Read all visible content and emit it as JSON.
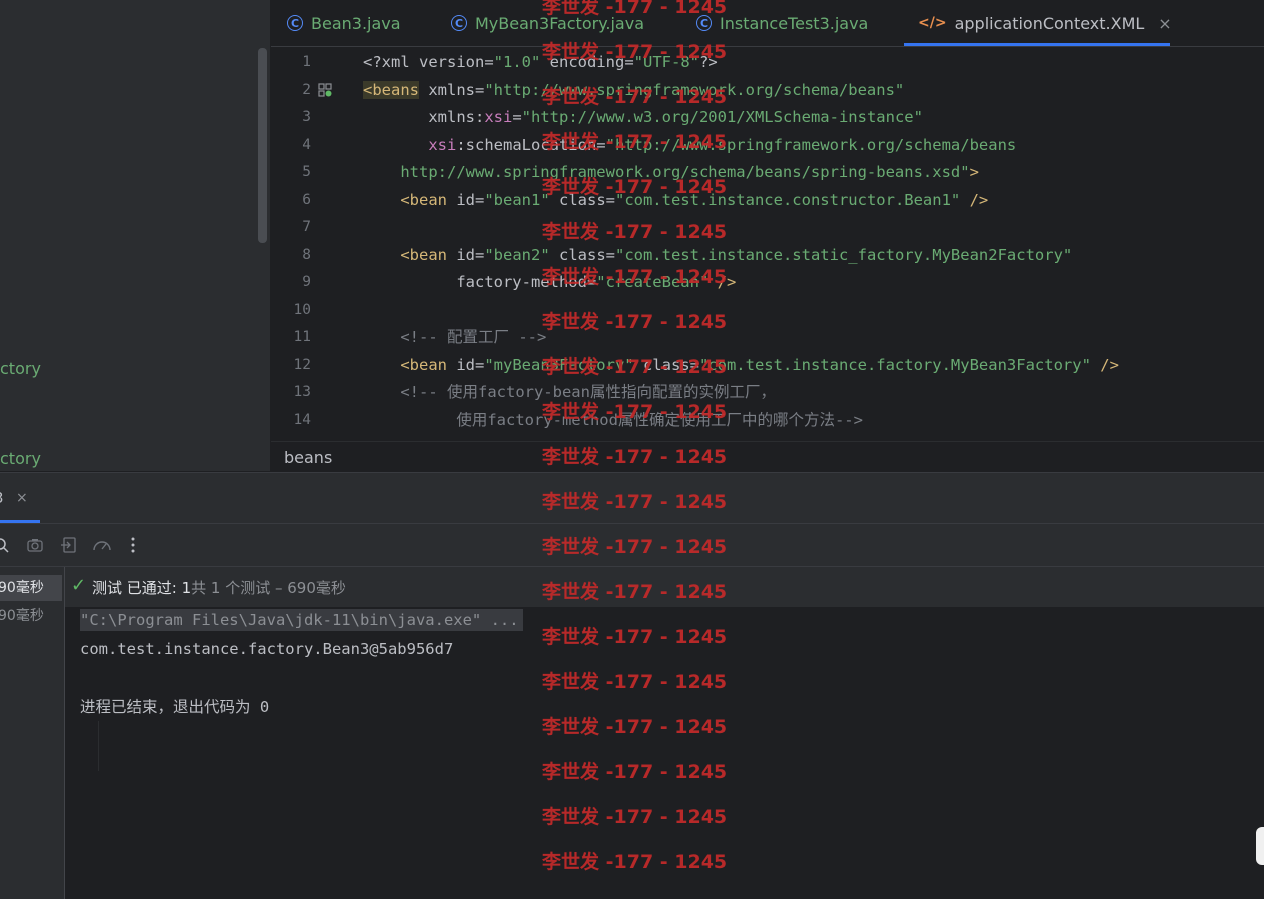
{
  "project_tree": {
    "items": [
      "ctory",
      "ctory"
    ]
  },
  "tabs": [
    {
      "label": "Bean3.java",
      "icon": "java-class-icon"
    },
    {
      "label": "MyBean3Factory.java",
      "icon": "java-class-icon"
    },
    {
      "label": "InstanceTest3.java",
      "icon": "java-class-icon"
    },
    {
      "label": "applicationContext.XML",
      "icon": "xml-file-icon",
      "active": true
    }
  ],
  "editor": {
    "lines": [
      {
        "n": "1",
        "segs": [
          [
            "t-attr",
            "<?xml version="
          ],
          [
            "t-str",
            "\"1.0\""
          ],
          [
            "t-attr",
            " encoding="
          ],
          [
            "t-str",
            "\"UTF-8\""
          ],
          [
            "t-attr",
            "?>"
          ]
        ]
      },
      {
        "n": "2",
        "segs": [
          [
            "t-tag t-tagbg",
            "<beans"
          ],
          [
            "t-attr",
            " xmlns="
          ],
          [
            "t-str",
            "\"http://www.springframework.org/schema/beans\""
          ]
        ]
      },
      {
        "n": "3",
        "segs": [
          [
            "t-attr",
            "       xmlns:"
          ],
          [
            "t-ns",
            "xsi"
          ],
          [
            "t-attr",
            "="
          ],
          [
            "t-str",
            "\"http://www.w3.org/2001/XMLSchema-instance\""
          ]
        ]
      },
      {
        "n": "4",
        "segs": [
          [
            "t-ns",
            "       xsi"
          ],
          [
            "t-attr",
            ":schemaLocation="
          ],
          [
            "t-str",
            "\"http://www.springframework.org/schema/beans"
          ]
        ]
      },
      {
        "n": "5",
        "segs": [
          [
            "t-str",
            "    http://www.springframework.org/schema/beans/spring-beans.xsd\""
          ],
          [
            "t-tag",
            ">"
          ]
        ]
      },
      {
        "n": "6",
        "segs": [
          [
            "t-tag",
            "    <bean"
          ],
          [
            "t-attr",
            " id="
          ],
          [
            "t-str",
            "\"bean1\""
          ],
          [
            "t-attr",
            " class="
          ],
          [
            "t-str",
            "\"com.test.instance.constructor.Bean1\""
          ],
          [
            "t-tag",
            " />"
          ]
        ]
      },
      {
        "n": "7",
        "segs": []
      },
      {
        "n": "8",
        "segs": [
          [
            "t-tag",
            "    <bean"
          ],
          [
            "t-attr",
            " id="
          ],
          [
            "t-str",
            "\"bean2\""
          ],
          [
            "t-attr",
            " class="
          ],
          [
            "t-str",
            "\"com.test.instance.static_factory.MyBean2Factory\""
          ]
        ]
      },
      {
        "n": "9",
        "segs": [
          [
            "t-attr",
            "          factory-method="
          ],
          [
            "t-str",
            "\"createBean\""
          ],
          [
            "t-tag",
            " />"
          ]
        ]
      },
      {
        "n": "10",
        "segs": []
      },
      {
        "n": "11",
        "segs": [
          [
            "t-com",
            "    <!-- 配置工厂 -->"
          ]
        ]
      },
      {
        "n": "12",
        "segs": [
          [
            "t-tag",
            "    <bean"
          ],
          [
            "t-attr",
            " id="
          ],
          [
            "t-str",
            "\"myBean3Factory\""
          ],
          [
            "t-attr",
            " class="
          ],
          [
            "t-str",
            "\"com.test.instance.factory.MyBean3Factory\""
          ],
          [
            "t-tag",
            " />"
          ]
        ]
      },
      {
        "n": "13",
        "segs": [
          [
            "t-com",
            "    <!-- 使用factory-bean属性指向配置的实例工厂，"
          ]
        ]
      },
      {
        "n": "14",
        "segs": [
          [
            "t-com",
            "          使用factory-method属性确定使用工厂中的哪个方法-->"
          ]
        ]
      }
    ]
  },
  "breadcrumb": "beans",
  "run_panel": {
    "tab_number": "3",
    "close_glyph": "×",
    "tree_times": [
      "90毫秒",
      "90毫秒"
    ],
    "status": {
      "prefix": "测试 已通过: ",
      "count": "1",
      "suffix": "共 1 个测试 – 690毫秒"
    },
    "console": {
      "command": "\"C:\\Program Files\\Java\\jdk-11\\bin\\java.exe\" ...",
      "output": "com.test.instance.factory.Bean3@5ab956d7",
      "exit": "进程已结束，退出代码为 0"
    }
  },
  "watermark": {
    "text": "李世发 -177 - 1245",
    "color": "#c42a2a"
  }
}
